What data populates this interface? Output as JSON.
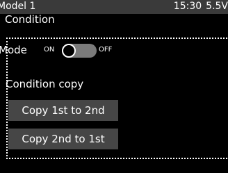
{
  "status_bar": {
    "model": "Model 1",
    "time": "15:30",
    "voltage": "5.5V"
  },
  "screen": {
    "title": "Condition"
  },
  "mode": {
    "label": "Mode",
    "on_label": "ON",
    "off_label": "OFF",
    "state": "off"
  },
  "condition_copy": {
    "label": "Condition copy",
    "buttons": [
      {
        "label": "Copy 1st to 2nd"
      },
      {
        "label": "Copy 2nd to 1st"
      }
    ]
  },
  "colors": {
    "background": "#000000",
    "status_bar": "#3a3a3a",
    "button": "#464646",
    "toggle_track": "#7a7a7a",
    "text": "#ffffff"
  }
}
